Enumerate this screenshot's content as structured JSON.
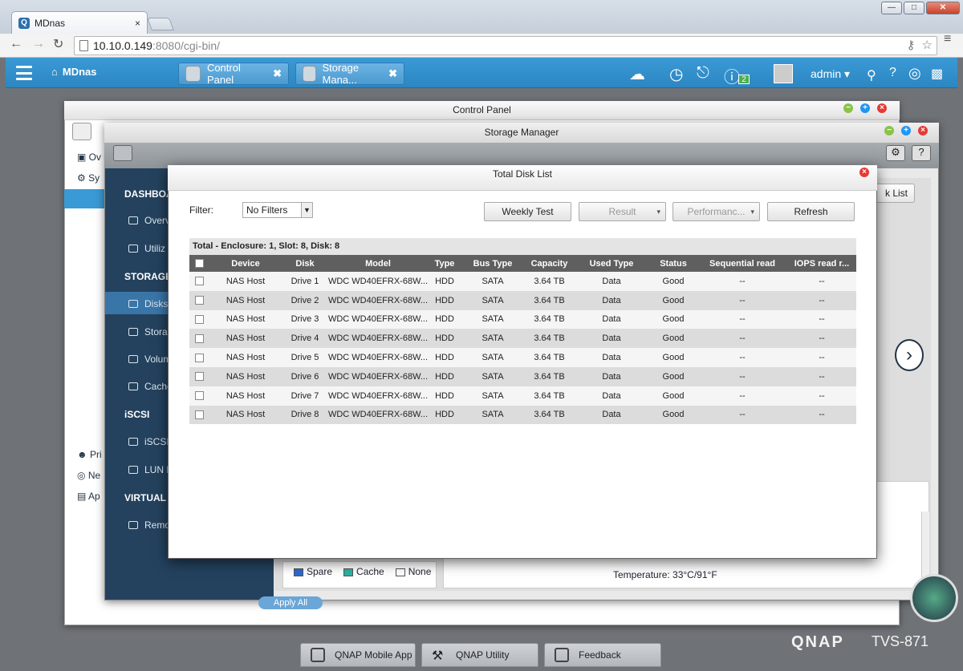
{
  "browser": {
    "tab_title": "MDnas",
    "tab_close": "×",
    "url_host": "10.10.0.149",
    "url_rest": ":8080/cgi-bin/",
    "win_min": "—",
    "win_max": "□",
    "win_close": "✕"
  },
  "qts": {
    "home_label": "MDnas",
    "tabs": [
      {
        "label": "Control Panel",
        "close": "✖"
      },
      {
        "label": "Storage Mana...",
        "close": "✖"
      }
    ],
    "notification_badge": "2",
    "user": "admin ▾"
  },
  "control_panel": {
    "title": "Control Panel",
    "sidebar_items": [
      "Ov",
      "Sy",
      "Pri",
      "Ne",
      "Ap"
    ]
  },
  "storage_manager": {
    "title": "Storage Manager",
    "sections": [
      {
        "header": "DASHBOA",
        "items": [
          "Overv",
          "Utiliz"
        ]
      },
      {
        "header": "STORAGE",
        "items": [
          "Disks",
          "Stora",
          "Volum",
          "Cache"
        ]
      },
      {
        "header": "iSCSI",
        "items": [
          "iSCSI",
          "LUN E"
        ]
      },
      {
        "header": "VIRTUAL D",
        "items": [
          "Remo"
        ]
      }
    ],
    "disk_list_btn": "k List",
    "legend": [
      "Spare",
      "Cache",
      "None"
    ],
    "temperature": "Temperature: 33°C/91°F",
    "apply_all": "Apply All"
  },
  "dialog": {
    "title": "Total Disk List",
    "filter_label": "Filter:",
    "filter_value": "No Filters",
    "buttons": {
      "weekly_test": "Weekly Test",
      "result": "Result",
      "performance": "Performanc...",
      "refresh": "Refresh"
    },
    "summary": "Total - Enclosure: 1, Slot: 8, Disk: 8",
    "columns": [
      "Device",
      "Disk",
      "Model",
      "Type",
      "Bus Type",
      "Capacity",
      "Used Type",
      "Status",
      "Sequential read",
      "IOPS read r..."
    ],
    "rows": [
      [
        "NAS Host",
        "Drive 1",
        "WDC WD40EFRX-68W...",
        "HDD",
        "SATA",
        "3.64 TB",
        "Data",
        "Good",
        "--",
        "--"
      ],
      [
        "NAS Host",
        "Drive 2",
        "WDC WD40EFRX-68W...",
        "HDD",
        "SATA",
        "3.64 TB",
        "Data",
        "Good",
        "--",
        "--"
      ],
      [
        "NAS Host",
        "Drive 3",
        "WDC WD40EFRX-68W...",
        "HDD",
        "SATA",
        "3.64 TB",
        "Data",
        "Good",
        "--",
        "--"
      ],
      [
        "NAS Host",
        "Drive 4",
        "WDC WD40EFRX-68W...",
        "HDD",
        "SATA",
        "3.64 TB",
        "Data",
        "Good",
        "--",
        "--"
      ],
      [
        "NAS Host",
        "Drive 5",
        "WDC WD40EFRX-68W...",
        "HDD",
        "SATA",
        "3.64 TB",
        "Data",
        "Good",
        "--",
        "--"
      ],
      [
        "NAS Host",
        "Drive 6",
        "WDC WD40EFRX-68W...",
        "HDD",
        "SATA",
        "3.64 TB",
        "Data",
        "Good",
        "--",
        "--"
      ],
      [
        "NAS Host",
        "Drive 7",
        "WDC WD40EFRX-68W...",
        "HDD",
        "SATA",
        "3.64 TB",
        "Data",
        "Good",
        "--",
        "--"
      ],
      [
        "NAS Host",
        "Drive 8",
        "WDC WD40EFRX-68W...",
        "HDD",
        "SATA",
        "3.64 TB",
        "Data",
        "Good",
        "--",
        "--"
      ]
    ]
  },
  "dock": {
    "items": [
      "QNAP Mobile App",
      "QNAP Utility",
      "Feedback"
    ]
  },
  "branding": {
    "logo": "QNAP",
    "model": "TVS-871"
  },
  "colors": {
    "accent": "#3a9ad5",
    "sidebar": "#24425e",
    "table_header": "#5f5f5f"
  }
}
